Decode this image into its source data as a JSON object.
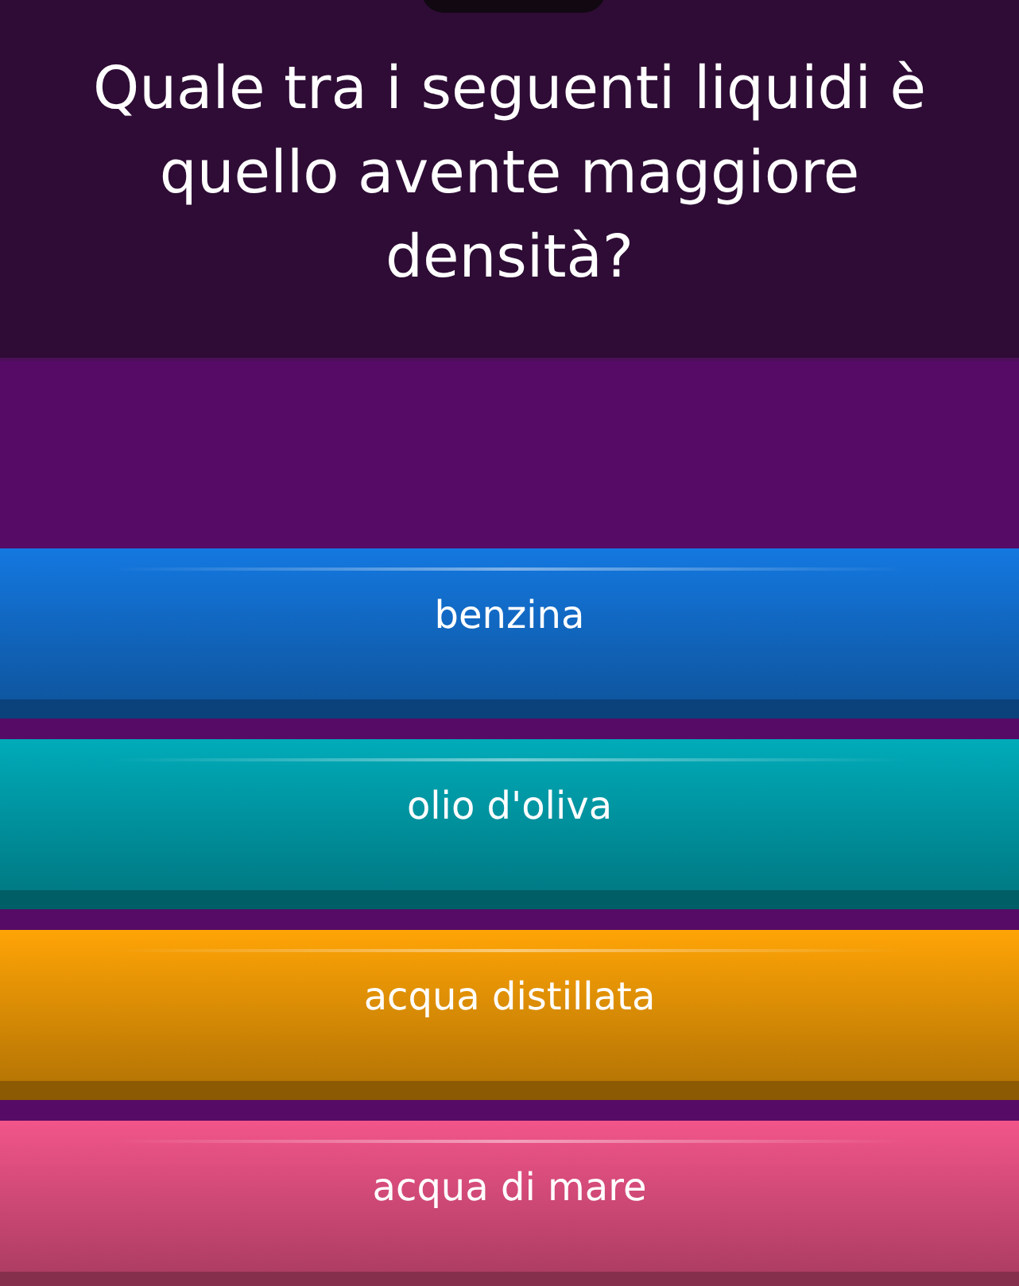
{
  "question": "Quale tra i seguenti liquidi è quello avente maggiore densità?",
  "answers": [
    {
      "label": "benzina",
      "color": "#1478e0"
    },
    {
      "label": "olio d'oliva",
      "color": "#00abb9"
    },
    {
      "label": "acqua distillata",
      "color": "#ffa406"
    },
    {
      "label": "acqua di mare",
      "color": "#f2558a"
    }
  ]
}
